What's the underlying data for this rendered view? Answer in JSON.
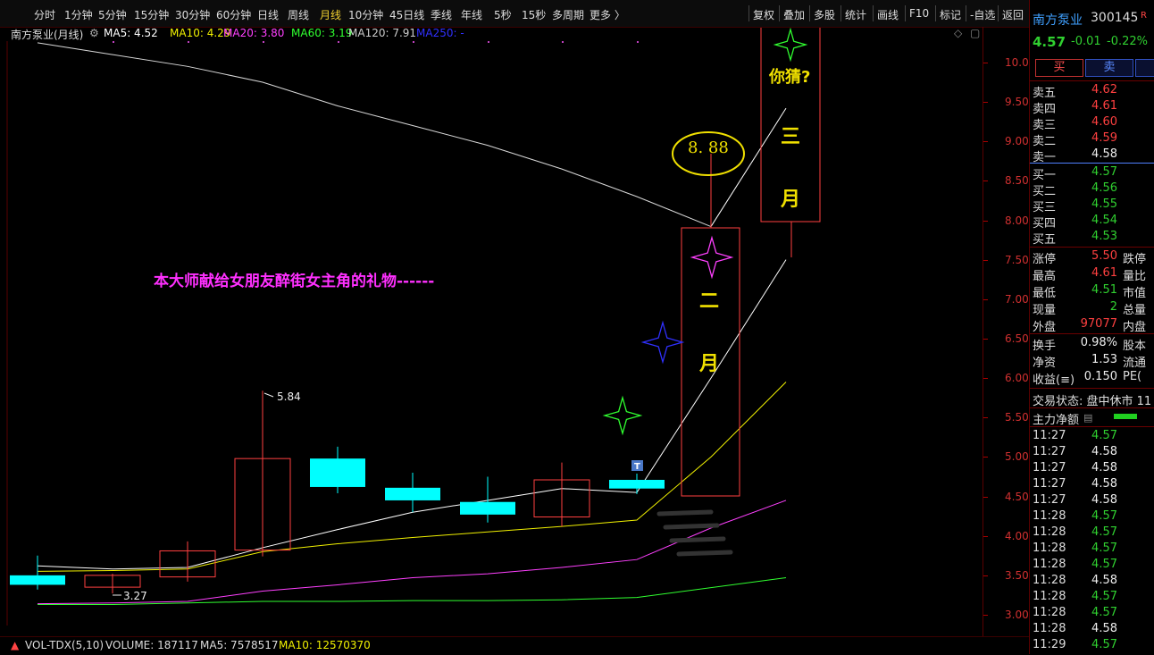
{
  "toolbar": {
    "items": [
      "分时",
      "1分钟",
      "5分钟",
      "15分钟",
      "30分钟",
      "60分钟",
      "日线",
      "周线",
      "月线",
      "10分钟",
      "45日线",
      "季线",
      "年线",
      "5秒",
      "15秒",
      "多周期",
      "更多 〉"
    ],
    "right_items": [
      "复权",
      "叠加",
      "多股",
      "统计",
      "画线",
      "F10",
      "标记",
      "-自选",
      "返回"
    ]
  },
  "ma_header": {
    "title": "南方泵业(月线)",
    "ma5": "MA5: 4.52",
    "ma10": "MA10: 4.29",
    "ma20": "MA20: 3.80",
    "ma60": "MA60: 3.19",
    "ma120": "MA120: 7.91",
    "ma250": "MA250: -",
    "colors": {
      "ma5": "#ffffff",
      "ma10": "#f0f000",
      "ma20": "#ff40ff",
      "ma60": "#30ff30",
      "ma120": "#cccccc",
      "ma250": "#3030ff"
    }
  },
  "annotations": {
    "banner": "本大师献给女朋友醉街女主角的礼物------",
    "price_bubble": "8. 88",
    "guess": "你猜?",
    "box_feb_1": "二",
    "box_feb_2": "月",
    "box_mar_1": "三",
    "box_mar_2": "月",
    "low_label": "3.27",
    "high_label": "5.84",
    "marker": "T"
  },
  "axis_ticks": [
    "10.00",
    "9.50",
    "9.00",
    "8.50",
    "8.00",
    "7.50",
    "7.00",
    "6.50",
    "6.00",
    "5.50",
    "5.00",
    "4.50",
    "4.00",
    "3.50",
    "3.00"
  ],
  "volume": {
    "name": "VOL-TDX(5,10)",
    "volume": "VOLUME: 187117",
    "ma5": "MA5: 7578517",
    "ma10": "MA10: 12570370"
  },
  "candles": [
    {
      "open": 3.38,
      "close": 3.5,
      "high": 3.75,
      "low": 3.32,
      "color": "cyan"
    },
    {
      "open": 3.5,
      "close": 3.35,
      "high": 3.52,
      "low": 3.27,
      "color": "red"
    },
    {
      "open": 3.48,
      "close": 3.81,
      "high": 3.93,
      "low": 3.42,
      "color": "red"
    },
    {
      "open": 3.82,
      "close": 4.98,
      "high": 5.84,
      "low": 3.74,
      "color": "red"
    },
    {
      "open": 4.98,
      "close": 4.62,
      "high": 5.13,
      "low": 4.54,
      "color": "cyan"
    },
    {
      "open": 4.61,
      "close": 4.45,
      "high": 4.8,
      "low": 4.3,
      "color": "cyan"
    },
    {
      "open": 4.43,
      "close": 4.27,
      "high": 4.75,
      "low": 4.17,
      "color": "cyan"
    },
    {
      "open": 4.24,
      "close": 4.71,
      "high": 4.93,
      "low": 4.12,
      "color": "red"
    },
    {
      "open": 4.71,
      "close": 4.6,
      "high": 4.79,
      "low": 4.53,
      "color": "cyan"
    }
  ],
  "quote": {
    "name": "南方泵业",
    "code": "300145",
    "flag": "R",
    "price": "4.57",
    "change": "-0.01",
    "change_pct": "-0.22%",
    "buy_btn": "买",
    "sell_btn": "卖",
    "sell_orders": [
      {
        "label": "卖五",
        "price": "4.62"
      },
      {
        "label": "卖四",
        "price": "4.61"
      },
      {
        "label": "卖三",
        "price": "4.60"
      },
      {
        "label": "卖二",
        "price": "4.59"
      },
      {
        "label": "卖一",
        "price": "4.58"
      }
    ],
    "buy_orders": [
      {
        "label": "买一",
        "price": "4.57"
      },
      {
        "label": "买二",
        "price": "4.56"
      },
      {
        "label": "买三",
        "price": "4.55"
      },
      {
        "label": "买四",
        "price": "4.54"
      },
      {
        "label": "买五",
        "price": "4.53"
      }
    ],
    "stats": [
      {
        "label": "涨停",
        "value": "5.50",
        "extra": "跌停",
        "color": "red"
      },
      {
        "label": "最高",
        "value": "4.61",
        "extra": "量比",
        "color": "red"
      },
      {
        "label": "最低",
        "value": "4.51",
        "extra": "市值",
        "color": "green"
      },
      {
        "label": "现量",
        "value": "2",
        "extra": "总量",
        "color": "green"
      },
      {
        "label": "外盘",
        "value": "97077",
        "extra": "内盘",
        "color": "red"
      }
    ],
    "stats2": [
      {
        "label": "换手",
        "value": "0.98%",
        "extra": "股本",
        "color": "white"
      },
      {
        "label": "净资",
        "value": "1.53",
        "extra": "流通",
        "color": "white"
      },
      {
        "label": "收益(≡)",
        "value": "0.150",
        "extra": "PE(",
        "color": "white"
      }
    ],
    "trade_status": "交易状态: 盘中休市 11",
    "main_flow": "主力净额",
    "ticks": [
      {
        "time": "11:27",
        "price": "4.57",
        "color": "green"
      },
      {
        "time": "11:27",
        "price": "4.58",
        "color": "white"
      },
      {
        "time": "11:27",
        "price": "4.58",
        "color": "white"
      },
      {
        "time": "11:27",
        "price": "4.58",
        "color": "white"
      },
      {
        "time": "11:27",
        "price": "4.58",
        "color": "white"
      },
      {
        "time": "11:28",
        "price": "4.57",
        "color": "green"
      },
      {
        "time": "11:28",
        "price": "4.57",
        "color": "green"
      },
      {
        "time": "11:28",
        "price": "4.57",
        "color": "green"
      },
      {
        "time": "11:28",
        "price": "4.57",
        "color": "green"
      },
      {
        "time": "11:28",
        "price": "4.58",
        "color": "white"
      },
      {
        "time": "11:28",
        "price": "4.57",
        "color": "green"
      },
      {
        "time": "11:28",
        "price": "4.57",
        "color": "green"
      },
      {
        "time": "11:28",
        "price": "4.58",
        "color": "white"
      },
      {
        "time": "11:29",
        "price": "4.57",
        "color": "green"
      }
    ]
  }
}
